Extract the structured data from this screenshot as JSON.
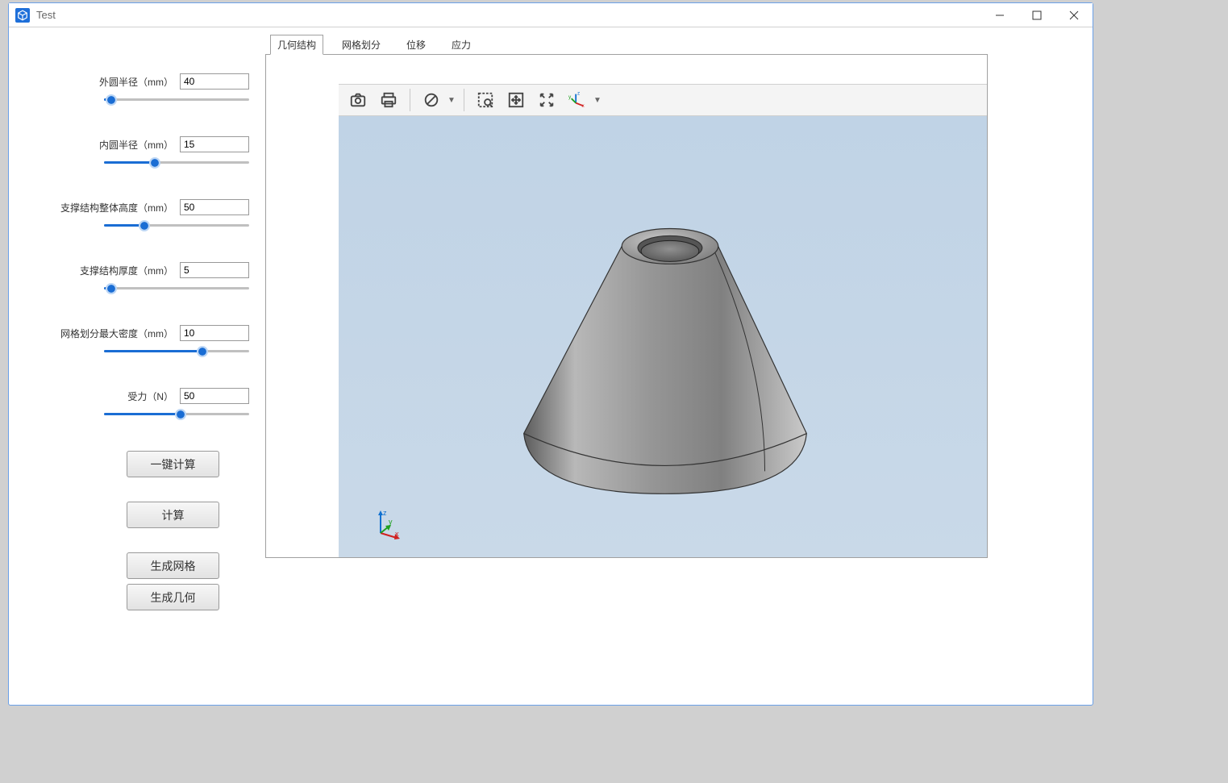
{
  "window": {
    "title": "Test"
  },
  "params": [
    {
      "label": "外圆半径（mm）",
      "value": "40",
      "slider_pct": 2
    },
    {
      "label": "内圆半径（mm）",
      "value": "15",
      "slider_pct": 32
    },
    {
      "label": "支撑结构整体高度（mm）",
      "value": "50",
      "slider_pct": 25
    },
    {
      "label": "支撑结构厚度（mm）",
      "value": "5",
      "slider_pct": 2
    },
    {
      "label": "网格划分最大密度（mm）",
      "value": "10",
      "slider_pct": 65
    },
    {
      "label": "受力（N）",
      "value": "50",
      "slider_pct": 50
    }
  ],
  "buttons": {
    "one_click": "一键计算",
    "calculate": "计算",
    "gen_mesh": "生成网格",
    "gen_geom": "生成几何"
  },
  "tabs": [
    {
      "label": "几何结构",
      "active": true
    },
    {
      "label": "网格划分",
      "active": false
    },
    {
      "label": "位移",
      "active": false
    },
    {
      "label": "应力",
      "active": false
    }
  ],
  "toolbar_icons": {
    "camera": "camera-icon",
    "print": "print-icon",
    "forbid": "forbid-icon",
    "zoom_box": "zoom-box-icon",
    "pan": "pan-icon",
    "fit": "fit-extents-icon",
    "axes": "axes-icon"
  },
  "axis_labels": {
    "x": "x",
    "y": "y",
    "z": "z"
  }
}
